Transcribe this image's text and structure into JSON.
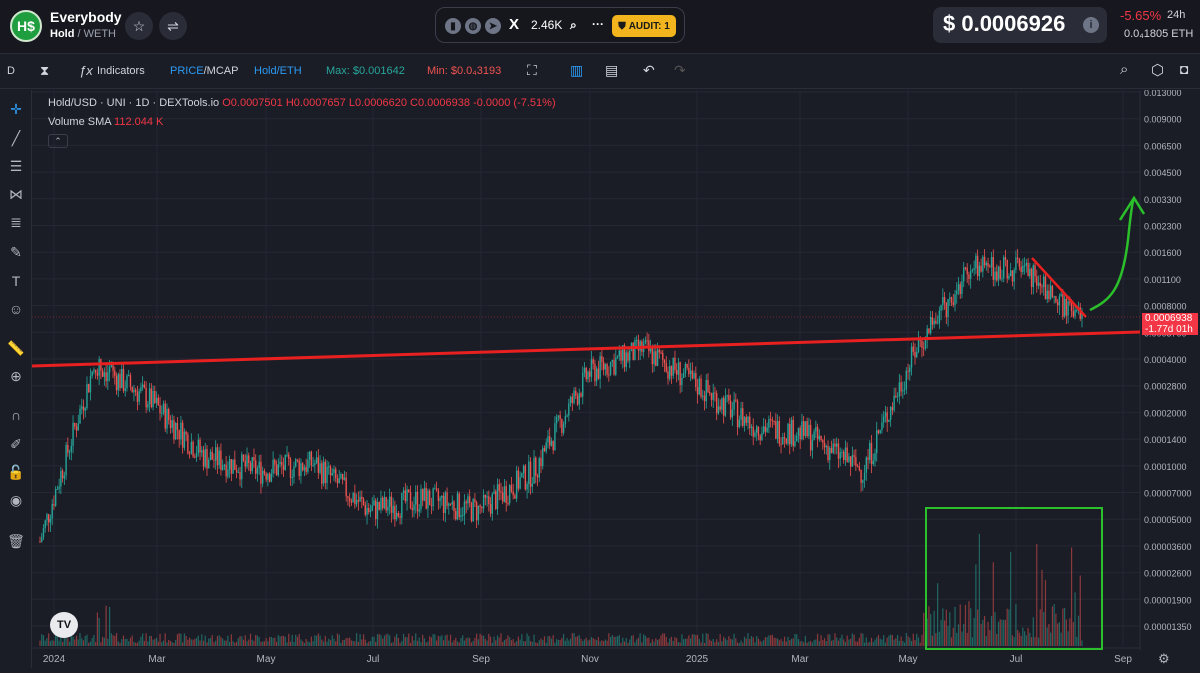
{
  "header": {
    "logo_text": "H$",
    "token_name": "Everybody",
    "pair_base": "Hold",
    "pair_quote": " / WETH",
    "followers": "2.46K",
    "more": "···",
    "audit_label": "AUDIT: 1",
    "price": "$ 0.0006926",
    "change": "-5.65%",
    "change_period": "24h",
    "eth_price": "0.0₄1805 ETH"
  },
  "toolbar": {
    "interval": "D",
    "indicators": "Indicators",
    "price_label": "PRICE",
    "mcap_label": "/MCAP",
    "hold_eth": "Hold/ETH",
    "max_label": "Max: $0.001642",
    "min_label": "Min: $0.0₄3193"
  },
  "legend": {
    "symbol": "Hold/USD · UNI · 1D · DEXTools.io",
    "open": "O0.0007501",
    "high": "H0.0007657",
    "low": "L0.0006620",
    "close": "C0.0006938",
    "change": "-0.0000 (-7.51%)",
    "volume_label": "Volume SMA",
    "volume_value": "112.044 K"
  },
  "tv_logo": "TV",
  "last_price_tag": "0.0006938",
  "last_price_tag2": "-1.77d 01h",
  "colors": {
    "up": "#26a69a",
    "down": "#ef5350",
    "annotation_red": "#e82020",
    "annotation_green": "#2bc02b"
  },
  "chart_data": {
    "type": "line",
    "title": "Hold/USD · UNI · 1D · DEXTools.io",
    "y_scale": "log",
    "x_ticks": [
      "2024",
      "Mar",
      "May",
      "Jul",
      "Sep",
      "Nov",
      "2025",
      "Mar",
      "May",
      "Jul",
      "Sep"
    ],
    "y_ticks": [
      "0.013000",
      "0.009000",
      "0.006500",
      "0.004500",
      "0.003300",
      "0.002300",
      "0.001600",
      "0.001100",
      "0.0008000",
      "0.0005700",
      "0.0004000",
      "0.0002800",
      "0.0002000",
      "0.0001400",
      "0.0001000",
      "0.00007000",
      "0.00005000",
      "0.00003600",
      "0.00002600",
      "0.00001900",
      "0.00001350"
    ],
    "series": [
      {
        "x": [
          "2024-01",
          "2024-02",
          "2024-03",
          "2024-04",
          "2024-05",
          "2024-06",
          "2024-07",
          "2024-08",
          "2024-09",
          "2024-10",
          "2024-11",
          "2024-12",
          "2025-01",
          "2025-02",
          "2025-03",
          "2025-04",
          "2025-05",
          "2025-06",
          "2025-07",
          "2025-08"
        ],
        "values": [
          4e-05,
          0.0004,
          0.00025,
          0.00012,
          0.0001,
          0.00011,
          6e-05,
          7e-05,
          6e-05,
          0.0001,
          0.00035,
          0.00048,
          0.0003,
          0.00018,
          0.00016,
          0.0001,
          0.0005,
          0.0014,
          0.0013,
          0.00069
        ]
      }
    ]
  }
}
